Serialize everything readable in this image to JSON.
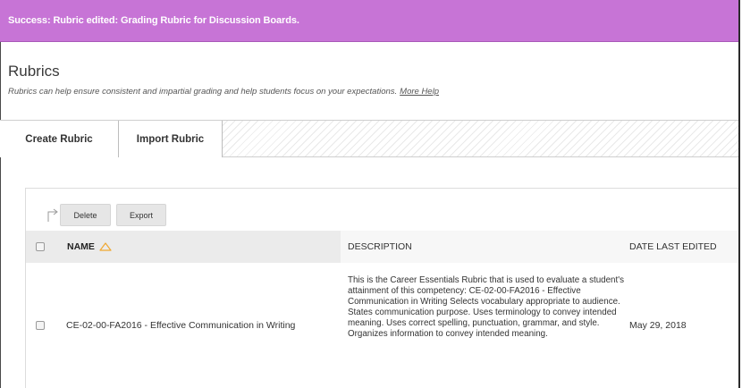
{
  "banner": {
    "message": "Success: Rubric edited: Grading Rubric for Discussion Boards.",
    "color": "#c774d6"
  },
  "page": {
    "title": "Rubrics",
    "subtitle": "Rubrics can help ensure consistent and impartial grading and help students focus on your expectations.",
    "help_link": "More Help"
  },
  "action_bar": {
    "create_label": "Create Rubric",
    "import_label": "Import Rubric"
  },
  "bulk_actions": {
    "delete_label": "Delete",
    "export_label": "Export",
    "icon": "bulk-arrow-icon"
  },
  "table": {
    "columns": {
      "name": "NAME",
      "description": "DESCRIPTION",
      "date": "DATE LAST EDITED"
    },
    "sort_icon": "sort-ascending-icon",
    "sort_color": "#f0a830",
    "rows": [
      {
        "name": "CE-02-00-FA2016 - Effective Communication in Writing",
        "description": "This is the Career Essentials Rubric that is used to evaluate a student's attainment of this competency: CE-02-00-FA2016 - Effective Communication in Writing Selects vocabulary appropriate to audience.  States communication purpose. Uses terminology to convey intended meaning.  Uses correct spelling, punctuation, grammar, and style.  Organizes information to convey intended meaning.",
        "date": "May 29, 2018"
      }
    ]
  }
}
